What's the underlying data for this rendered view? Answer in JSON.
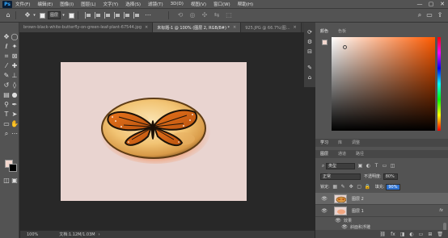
{
  "menubar": {
    "logo": "Ps",
    "items": [
      "文件(F)",
      "编辑(E)",
      "图像(I)",
      "图层(L)",
      "文字(Y)",
      "选择(S)",
      "滤镜(T)",
      "3D(D)",
      "视图(V)",
      "窗口(W)",
      "帮助(H)"
    ],
    "window_controls": [
      "—",
      "▢",
      "✕"
    ]
  },
  "options": {
    "auto_select_label": "图层",
    "move_icon": "move-icon"
  },
  "tabs": [
    {
      "label": "brown-black-white-butterfly-on-green-leaf-plant-67544.jpg",
      "close": "×"
    },
    {
      "label": "未标题-1 @ 100% (图层 2, RGB/8#) *",
      "close": "×"
    },
    {
      "label": "925.JPG @ 66.7%(图...",
      "close": "×"
    }
  ],
  "statusbar": {
    "zoom": "100%",
    "doc_info": "文档:1.12M/1.03M"
  },
  "color_panel": {
    "tabs": [
      "颜色",
      "色板"
    ],
    "fg_color": "#f3d8cf",
    "bg_color": "#000000",
    "hue": "#ff5a00"
  },
  "learn_panel": {
    "tabs": [
      "学习",
      "库",
      "调整"
    ]
  },
  "layers_panel": {
    "tabs": [
      "图层",
      "通道",
      "路径"
    ],
    "filter_label": "类型",
    "blend_mode": "正常",
    "opacity_label": "不透明度:",
    "opacity_value": "80%",
    "lock_label": "锁定:",
    "fill_label": "填充:",
    "fill_value": "90%",
    "layers": [
      {
        "name": "图层 2",
        "selected": true
      },
      {
        "name": "图层 1",
        "selected": false,
        "fx": "fx"
      }
    ],
    "effects_label": "效果",
    "effect_item": "斜面和浮雕",
    "footer_icons": [
      "link-icon",
      "fx-icon",
      "mask-icon",
      "adjustment-icon",
      "group-icon",
      "new-layer-icon",
      "trash-icon"
    ],
    "footer_glyphs": [
      "⛓",
      "fx",
      "◨",
      "◐",
      "▭",
      "⊞",
      "🗑"
    ]
  }
}
